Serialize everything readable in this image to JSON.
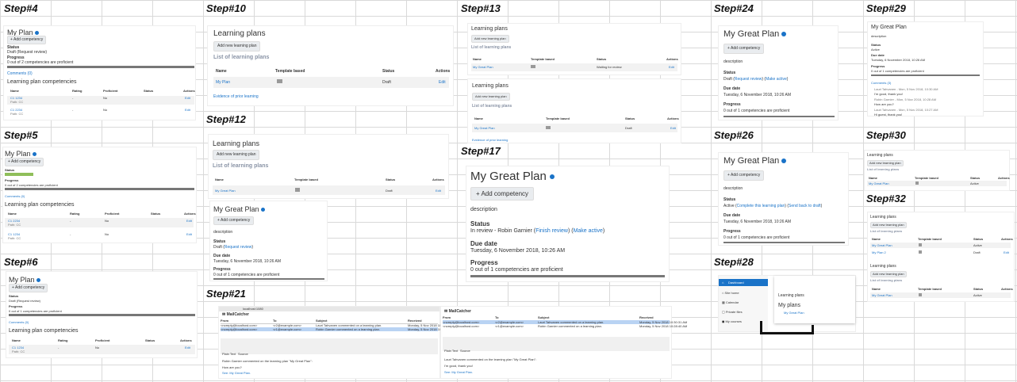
{
  "steps": [
    "Step#4",
    "Step#10",
    "Step#13",
    "Step#24",
    "Step#29",
    "Step#5",
    "Step#12",
    "Step#17",
    "Step#26",
    "Step#30",
    "Step#6",
    "Step#32",
    "Step#21",
    "Step#28"
  ],
  "common": {
    "my_plan": "My Plan",
    "my_great_plan": "My Great Plan",
    "add_competency": "Add competency",
    "status": "Status",
    "progress": "Progress",
    "due_date": "Due date",
    "description": "description",
    "learning_plans": "Learning plans",
    "add_new_learning_plan": "Add new learning plan",
    "list_of_learning_plans": "List of learning plans",
    "col_name": "Name",
    "col_template_based": "Template based",
    "col_status": "Status",
    "col_actions": "Actions",
    "col_rating": "Rating",
    "col_proficient": "Proficient",
    "edit": "Edit",
    "no": "No",
    "dash": "-",
    "comments_0": "Comments (0)",
    "comments_3": "Comments (3)",
    "competencies_heading": "Learning plan competencies",
    "progress_text": "0 out of 1 competencies are proficient",
    "progress_text_2": "0 out of 2 competencies are proficient",
    "due_text": "Tuesday, 6 November 2018, 10:26 AM",
    "evidence": "Evidence of prior learning",
    "draft": "Draft",
    "active": "Active",
    "waiting_review": "Waiting for review",
    "comp_c1": "C1 1234",
    "comp_c2": "C1 2234",
    "path": "Path:",
    "path_val": "CC"
  },
  "step4": {
    "status_value": "Draft (Request review)"
  },
  "step24": {
    "status_prefix": "Draft (",
    "req": "Request review",
    "mid": ") (",
    "make": "Make active",
    "suffix": ")"
  },
  "step26": {
    "status_prefix": "Active (",
    "complete": "Complete this learning plan",
    "mid": ") (",
    "send": "Send back to draft",
    "suffix": ")"
  },
  "step17": {
    "status_prefix": "In review - Robin Garnier (",
    "finish": "Finish review",
    "mid": ") (",
    "make": "Make active",
    "suffix": ")"
  },
  "step12": {
    "status_prefix": "Draft (",
    "req": "Request review",
    "suffix": ")"
  },
  "step28": {
    "dashboard": "Dashboard",
    "site_home": "Site home",
    "calendar": "Calendar",
    "private_files": "Private files",
    "my_courses": "My courses",
    "learning_plans": "Learning plans",
    "my_plans": "My plans",
    "link": "My Great Plan"
  },
  "step21": {
    "app": "MailCatcher",
    "url": "localhost:1080",
    "col_from": "From",
    "col_to": "To",
    "col_subject": "Subject",
    "col_received": "Received",
    "row1_from": "<noreply@localhost.com>",
    "row1_to": "<r2@example.com>",
    "row1_subject": "Lauri Tahvanen commented on a learning plan.",
    "row1_received": "Monday, 5 Nov 2018 10:30:31 AM",
    "row2_from": "<noreply@localhost.com>",
    "row2_to": "<r1@example.com>",
    "row2_subject": "Robin Garnier commented on a learning plan.",
    "row2_received": "Monday, 5 Nov 2018 10:28:40 AM",
    "body1": "Robin Garnier commented on the learning plan \"My Great Plan\":",
    "body2": "How are you?",
    "body3": "See: My Great Plan.",
    "body4": "Lauri Tahvanen commented on the learning plan \"My Great Plan\":",
    "body5": "I'm good, thank you!",
    "tab_plain": "Plain Text",
    "tab_source": "Source"
  },
  "step29": {
    "c1": "Lauri Tahvanen - Mon, 5 Nov 2018, 10:30 AM",
    "c1t": "I'm good, thank you!",
    "c2": "Robin Garnier - Mon, 5 Nov 2018, 10:28 AM",
    "c2t": "How are you?",
    "c3": "Lauri Tahvanen - Mon, 5 Nov 2018, 10:27 AM",
    "c3t": "Hi guest, thank you!"
  },
  "step32": {
    "my_plan_2": "My Plan 2"
  }
}
